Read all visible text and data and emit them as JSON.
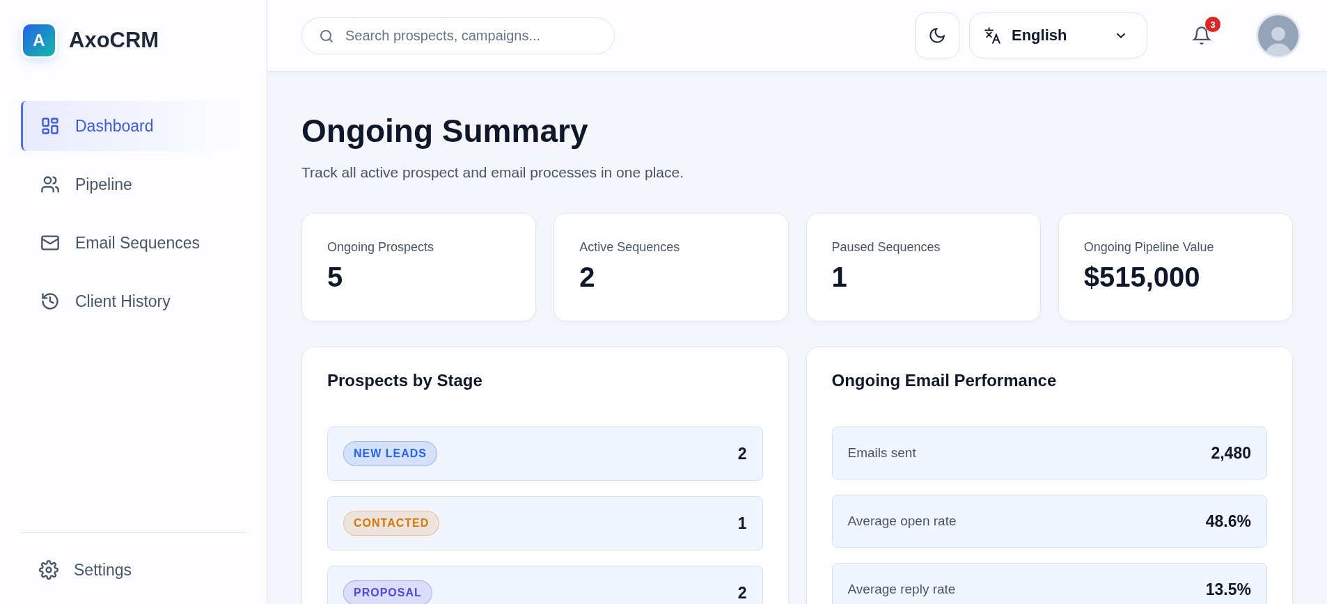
{
  "brand": {
    "name": "AxoCRM",
    "logo_letter": "A"
  },
  "nav": [
    {
      "label": "Dashboard",
      "selected": true
    },
    {
      "label": "Pipeline",
      "selected": false
    },
    {
      "label": "Email Sequences",
      "selected": false
    },
    {
      "label": "Client History",
      "selected": false
    }
  ],
  "settings": {
    "label": "Settings"
  },
  "search": {
    "placeholder": "Search prospects, campaigns..."
  },
  "language": {
    "value": "English"
  },
  "notifications": {
    "count": "3"
  },
  "page": {
    "title": "Ongoing Summary",
    "subtitle": "Track all active prospect and email processes in one place."
  },
  "stats": [
    {
      "label": "Ongoing Prospects",
      "value": "5"
    },
    {
      "label": "Active Sequences",
      "value": "2"
    },
    {
      "label": "Paused Sequences",
      "value": "1"
    },
    {
      "label": "Ongoing Pipeline Value",
      "value": "$515,000"
    }
  ],
  "stages": {
    "title": "Prospects by Stage",
    "rows": [
      {
        "label": "NEW LEADS",
        "count": "2",
        "color": "#2563eb"
      },
      {
        "label": "CONTACTED",
        "count": "1",
        "color": "#d97706"
      },
      {
        "label": "PROPOSAL",
        "count": "2",
        "color": "#4f46e5"
      }
    ]
  },
  "email_performance": {
    "title": "Ongoing Email Performance",
    "rows": [
      {
        "label": "Emails sent",
        "value": "2,480"
      },
      {
        "label": "Average open rate",
        "value": "48.6%"
      },
      {
        "label": "Average reply rate",
        "value": "13.5%"
      }
    ]
  }
}
